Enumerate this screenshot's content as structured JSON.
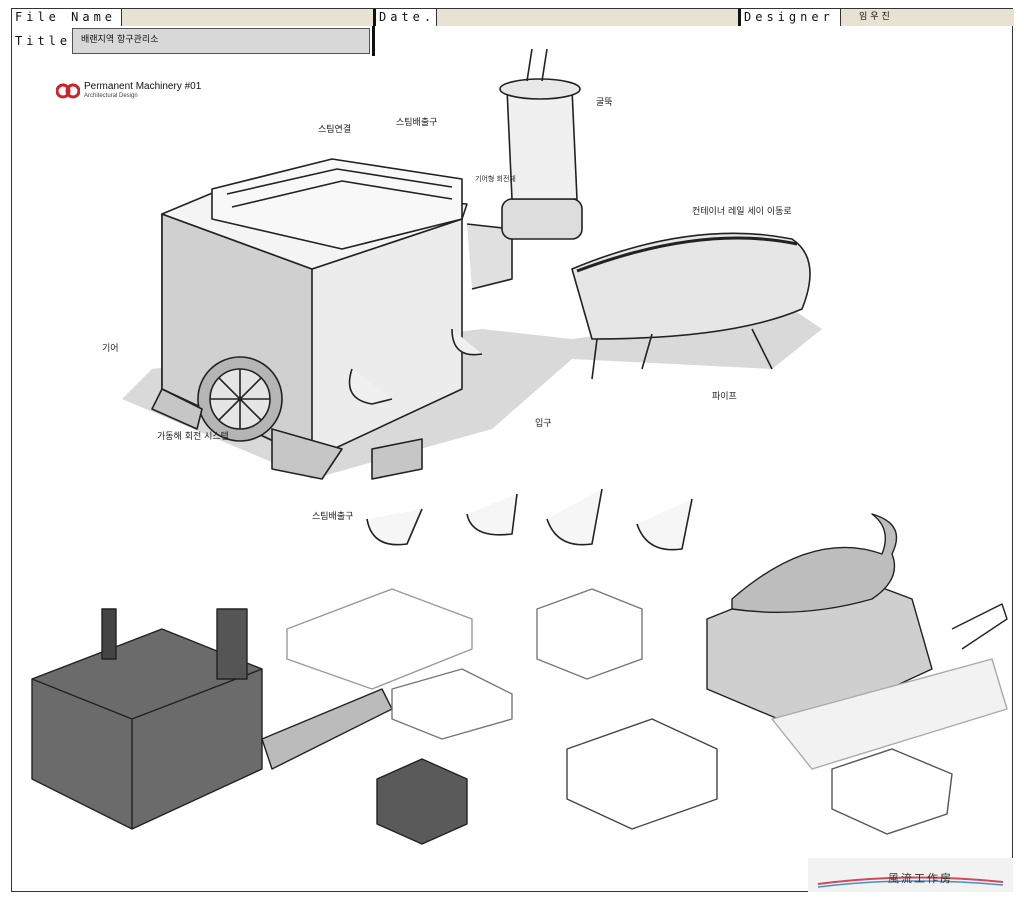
{
  "header": {
    "file_name_label": "File Name",
    "file_name_value": "",
    "date_label": "Date.",
    "date_value": "",
    "designer_label": "Designer",
    "designer_value": "임우진",
    "title_label": "Title:",
    "title_value": "배랜지역 항구관리소"
  },
  "logo": {
    "line1": "Permanent Machinery  #01",
    "line2": "Architectural Design",
    "brand_color": "#c8252c"
  },
  "annotations": {
    "top_left": "스팀연결",
    "top_mid": "스팀배출구",
    "chimney": "굴뚝",
    "chimney_side": "기어형\n회전체",
    "rail_top": "컨테이너 레일 세이\n이동로",
    "left_pipe": "기어",
    "gear": "가동해 회전\n시스템",
    "bottom_mid": "입구",
    "bottom_left": "스팀배출구",
    "pipe": "파이프"
  },
  "studio": {
    "name": "風流工作房"
  }
}
